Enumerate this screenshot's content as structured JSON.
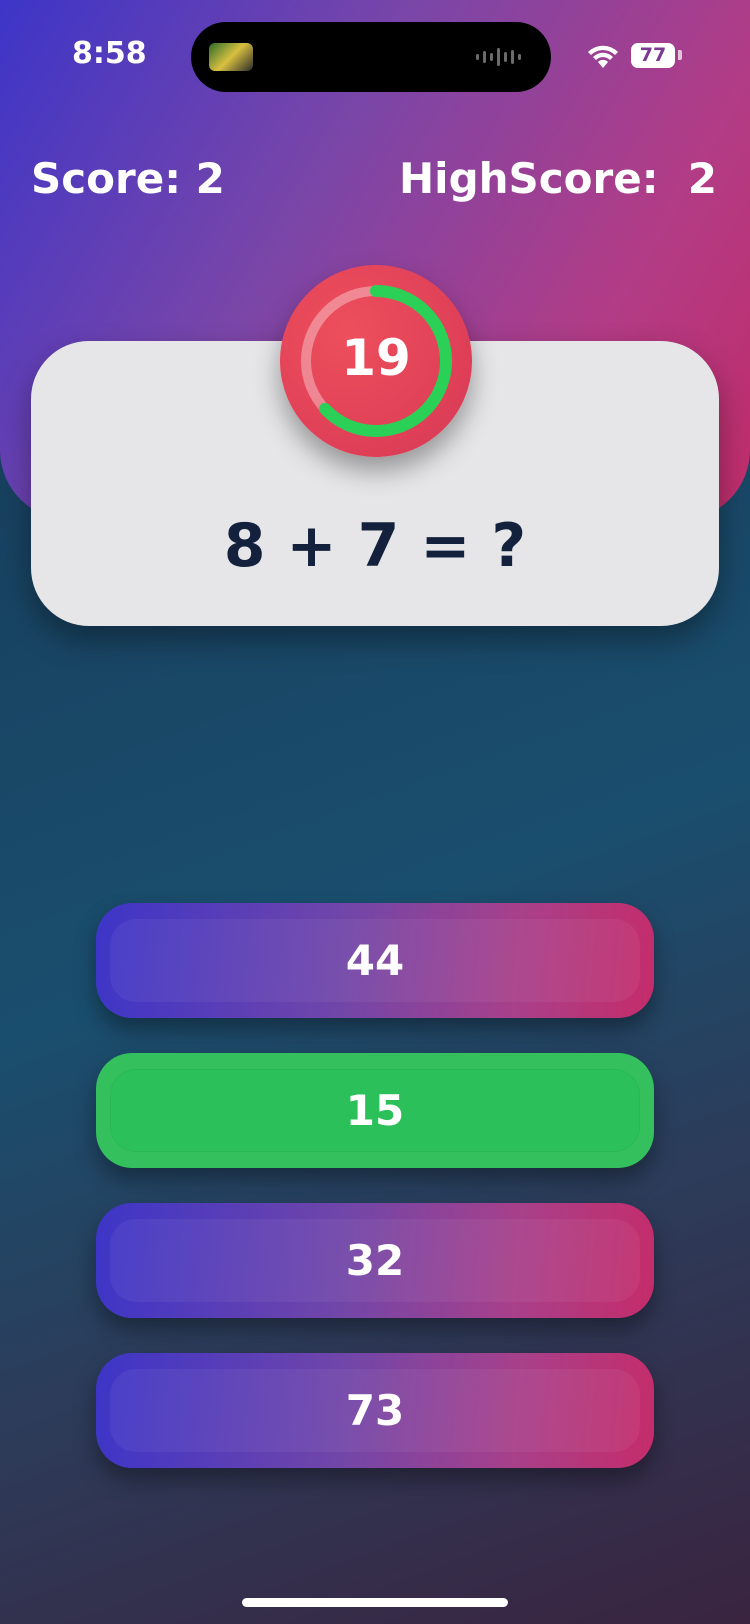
{
  "status_bar": {
    "time": "8:58",
    "battery": "77"
  },
  "header": {
    "score_label": "Score: 2",
    "highscore_label": "HighScore:  2"
  },
  "timer": {
    "seconds": "19",
    "remaining_fraction": 0.63
  },
  "question": {
    "text": "8 + 7 = ?"
  },
  "answers": [
    {
      "label": "44",
      "state": "default"
    },
    {
      "label": "15",
      "state": "correct"
    },
    {
      "label": "32",
      "state": "default"
    },
    {
      "label": "73",
      "state": "default"
    }
  ],
  "colors": {
    "correct": "#34c05d",
    "timer_ring": "#2bd157",
    "timer_fill": "#e04358",
    "gradient_start": "#3d35c8",
    "gradient_end": "#c52c6a",
    "question_text": "#14213d"
  }
}
